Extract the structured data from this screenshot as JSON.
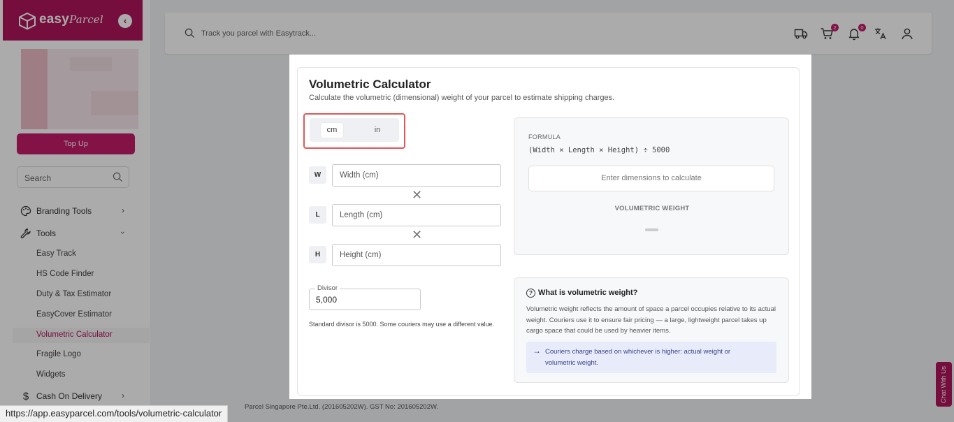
{
  "brand": {
    "name": "easy",
    "script": "Parcel",
    "color": "#b0155c"
  },
  "sidebar": {
    "topup_label": "Top Up",
    "search_placeholder": "Search",
    "items": [
      {
        "label": "Branding Tools",
        "icon": "palette-icon"
      },
      {
        "label": "Tools",
        "icon": "wrench-icon"
      },
      {
        "label": "Cash On Delivery",
        "icon": "dollar-icon"
      }
    ],
    "tools_sub": [
      "Easy Track",
      "HS Code Finder",
      "Duty & Tax Estimator",
      "EasyCover Estimator",
      "Volumetric Calculator",
      "Fragile Logo",
      "Widgets"
    ]
  },
  "header": {
    "search_placeholder": "Track you parcel with Easytrack...",
    "cart_badge": "2",
    "notif_badge": "0"
  },
  "footer": {
    "copyright": "Parcel Singapore Pte.Ltd. (201605202W). GST No: 201605202W.",
    "status_url": "https://app.easyparcel.com/tools/volumetric-calculator",
    "chat_label": "Chat With Us"
  },
  "calculator": {
    "title": "Volumetric Calculator",
    "subtitle": "Calculate the volumetric (dimensional) weight of your parcel to estimate shipping charges.",
    "units": {
      "active": "cm",
      "other": "in"
    },
    "dims": [
      {
        "tag": "W",
        "placeholder": "Width (cm)"
      },
      {
        "tag": "L",
        "placeholder": "Length (cm)"
      },
      {
        "tag": "H",
        "placeholder": "Height (cm)"
      }
    ],
    "times_symbol": "✕",
    "divisor_label": "Divisor",
    "divisor_value": "5,000",
    "divisor_note": "Standard divisor is 5000. Some couriers may use a different value.",
    "formula_label": "FORMULA",
    "formula": "(Width × Length × Height) ÷ 5000",
    "calc_placeholder": "Enter dimensions to calculate",
    "result_label": "VOLUMETRIC WEIGHT",
    "info_title": "What is volumetric weight?",
    "info_body": "Volumetric weight reflects the amount of space a parcel occupies relative to its actual weight. Couriers use it to ensure fair pricing — a large, lightweight parcel takes up cargo space that could be used by heavier items.",
    "info_callout": "Couriers charge based on whichever is higher: actual weight or volumetric weight."
  }
}
